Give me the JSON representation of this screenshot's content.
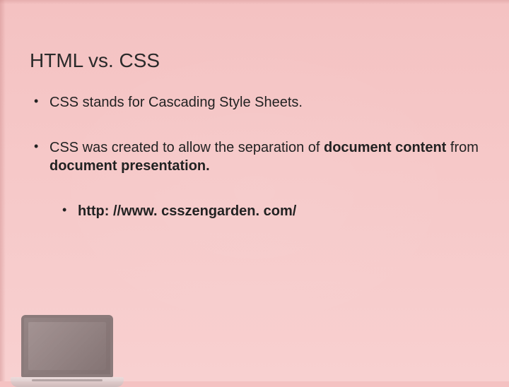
{
  "slide": {
    "title": "HTML vs. CSS",
    "bullets": [
      {
        "text_parts": [
          "CSS stands for Cascading Style Sheets."
        ]
      },
      {
        "text_parts": [
          "CSS was created to allow the separation of ",
          "document content",
          " from ",
          "document presentation."
        ],
        "bold_indices": [
          1,
          3
        ],
        "sub": [
          "http: //www. csszengarden. com/"
        ]
      }
    ]
  }
}
